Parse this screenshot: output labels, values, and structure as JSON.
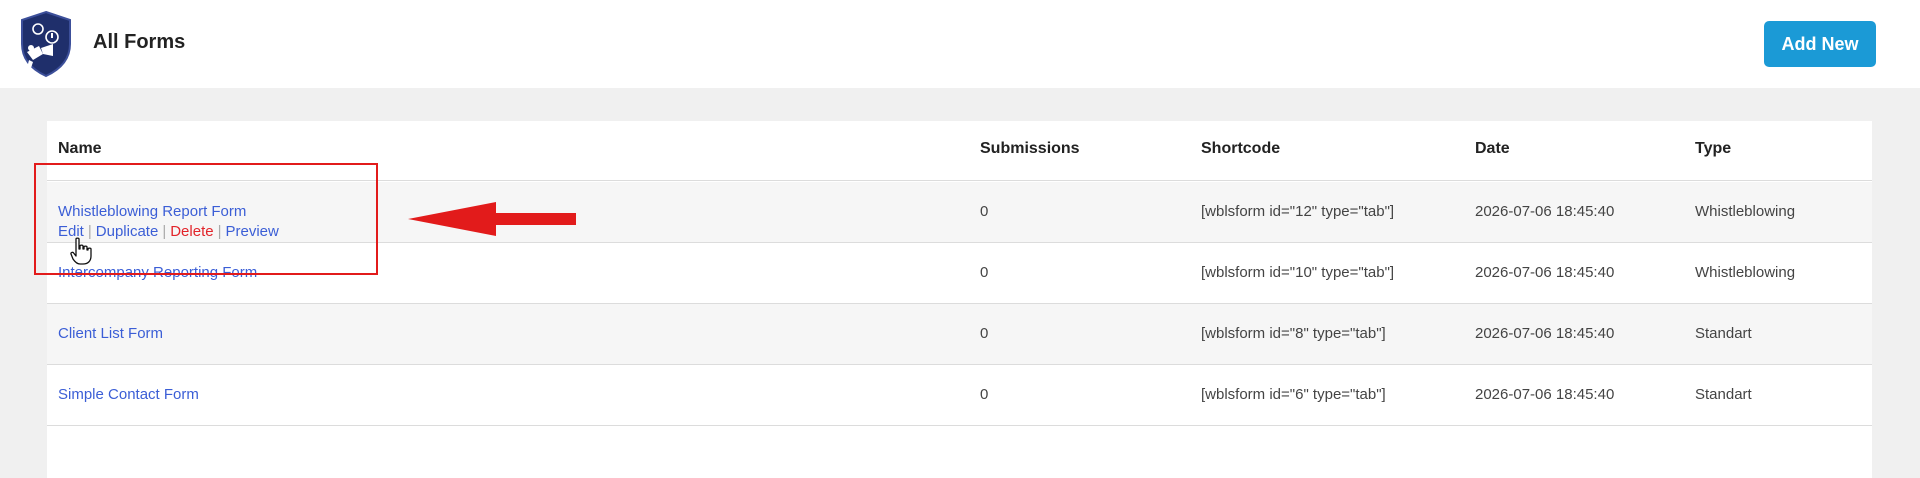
{
  "header": {
    "title": "All Forms",
    "add_new_label": "Add New",
    "logo_icon": "shield-logo-icon"
  },
  "table": {
    "columns": [
      "Name",
      "Submissions",
      "Shortcode",
      "Date",
      "Type"
    ],
    "rows": [
      {
        "name": "Whistleblowing Report Form",
        "submissions": "0",
        "shortcode": "[wblsform id=\"12\" type=\"tab\"]",
        "date": "2026-07-06 18:45:40",
        "type": "Whistleblowing"
      },
      {
        "name": "Intercompany Reporting Form",
        "submissions": "0",
        "shortcode": "[wblsform id=\"10\" type=\"tab\"]",
        "date": "2026-07-06 18:45:40",
        "type": "Whistleblowing"
      },
      {
        "name": "Client List Form",
        "submissions": "0",
        "shortcode": "[wblsform id=\"8\" type=\"tab\"]",
        "date": "2026-07-06 18:45:40",
        "type": "Standart"
      },
      {
        "name": "Simple Contact Form",
        "submissions": "0",
        "shortcode": "[wblsform id=\"6\" type=\"tab\"]",
        "date": "2026-07-06 18:45:40",
        "type": "Standart"
      }
    ],
    "row_actions": {
      "edit": "Edit",
      "duplicate": "Duplicate",
      "delete": "Delete",
      "preview": "Preview",
      "separator": "|"
    }
  },
  "colors": {
    "accent": "#1b9ad6",
    "link": "#3b5ed6",
    "delete": "#e2242a",
    "annotation": "#e21b1b"
  }
}
